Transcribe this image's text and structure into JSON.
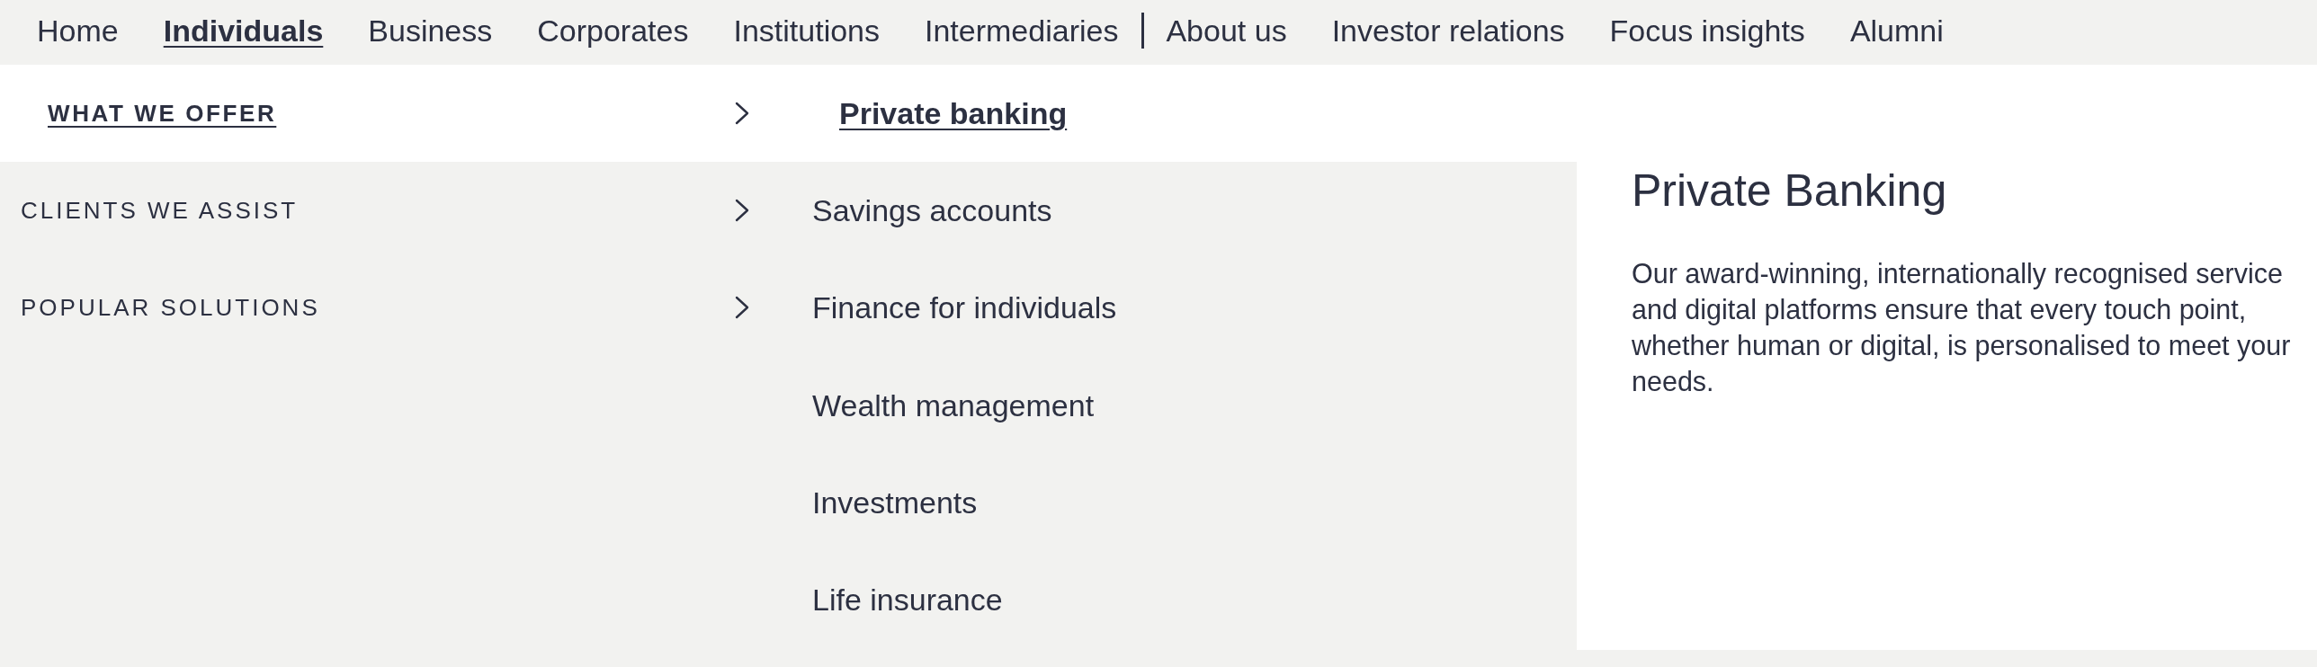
{
  "nav": {
    "segment_links": [
      {
        "label": "Home",
        "selected": false
      },
      {
        "label": "Individuals",
        "selected": true
      },
      {
        "label": "Business",
        "selected": false
      },
      {
        "label": "Corporates",
        "selected": false
      },
      {
        "label": "Institutions",
        "selected": false
      },
      {
        "label": "Intermediaries",
        "selected": false
      }
    ],
    "company_links": [
      {
        "label": "About us",
        "selected": false
      },
      {
        "label": "Investor relations",
        "selected": false
      },
      {
        "label": "Focus insights",
        "selected": false
      },
      {
        "label": "Alumni",
        "selected": false
      }
    ]
  },
  "menu": {
    "categories": [
      {
        "label": "WHAT WE OFFER",
        "selected": true
      },
      {
        "label": "CLIENTS WE ASSIST",
        "selected": false
      },
      {
        "label": "POPULAR SOLUTIONS",
        "selected": false
      }
    ],
    "links": [
      {
        "label": "Private banking",
        "selected": true
      },
      {
        "label": "Savings accounts",
        "selected": false
      },
      {
        "label": "Finance for individuals",
        "selected": false
      },
      {
        "label": "Wealth management",
        "selected": false
      },
      {
        "label": "Investments",
        "selected": false
      },
      {
        "label": "Life insurance",
        "selected": false
      }
    ],
    "feature": {
      "title": "Private Banking",
      "text": "Our award-winning, internationally recognised service and digital platforms ensure that every touch point, whether human or digital, is personalised to meet your needs."
    }
  }
}
